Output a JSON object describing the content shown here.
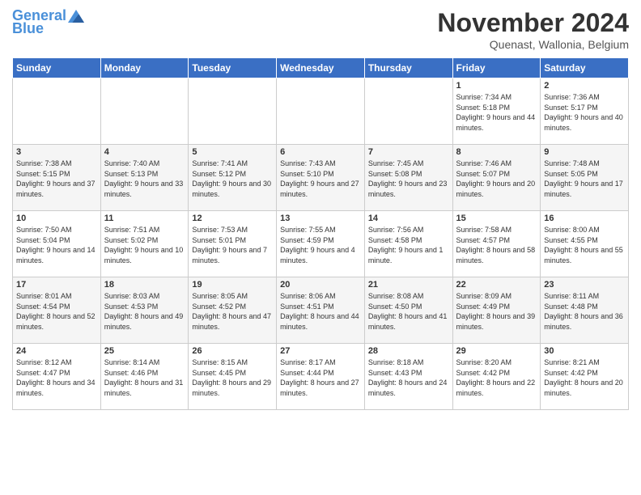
{
  "header": {
    "logo_line1": "General",
    "logo_line2": "Blue",
    "month_title": "November 2024",
    "location": "Quenast, Wallonia, Belgium"
  },
  "days_of_week": [
    "Sunday",
    "Monday",
    "Tuesday",
    "Wednesday",
    "Thursday",
    "Friday",
    "Saturday"
  ],
  "weeks": [
    [
      {
        "day": "",
        "info": ""
      },
      {
        "day": "",
        "info": ""
      },
      {
        "day": "",
        "info": ""
      },
      {
        "day": "",
        "info": ""
      },
      {
        "day": "",
        "info": ""
      },
      {
        "day": "1",
        "info": "Sunrise: 7:34 AM\nSunset: 5:18 PM\nDaylight: 9 hours and 44 minutes."
      },
      {
        "day": "2",
        "info": "Sunrise: 7:36 AM\nSunset: 5:17 PM\nDaylight: 9 hours and 40 minutes."
      }
    ],
    [
      {
        "day": "3",
        "info": "Sunrise: 7:38 AM\nSunset: 5:15 PM\nDaylight: 9 hours and 37 minutes."
      },
      {
        "day": "4",
        "info": "Sunrise: 7:40 AM\nSunset: 5:13 PM\nDaylight: 9 hours and 33 minutes."
      },
      {
        "day": "5",
        "info": "Sunrise: 7:41 AM\nSunset: 5:12 PM\nDaylight: 9 hours and 30 minutes."
      },
      {
        "day": "6",
        "info": "Sunrise: 7:43 AM\nSunset: 5:10 PM\nDaylight: 9 hours and 27 minutes."
      },
      {
        "day": "7",
        "info": "Sunrise: 7:45 AM\nSunset: 5:08 PM\nDaylight: 9 hours and 23 minutes."
      },
      {
        "day": "8",
        "info": "Sunrise: 7:46 AM\nSunset: 5:07 PM\nDaylight: 9 hours and 20 minutes."
      },
      {
        "day": "9",
        "info": "Sunrise: 7:48 AM\nSunset: 5:05 PM\nDaylight: 9 hours and 17 minutes."
      }
    ],
    [
      {
        "day": "10",
        "info": "Sunrise: 7:50 AM\nSunset: 5:04 PM\nDaylight: 9 hours and 14 minutes."
      },
      {
        "day": "11",
        "info": "Sunrise: 7:51 AM\nSunset: 5:02 PM\nDaylight: 9 hours and 10 minutes."
      },
      {
        "day": "12",
        "info": "Sunrise: 7:53 AM\nSunset: 5:01 PM\nDaylight: 9 hours and 7 minutes."
      },
      {
        "day": "13",
        "info": "Sunrise: 7:55 AM\nSunset: 4:59 PM\nDaylight: 9 hours and 4 minutes."
      },
      {
        "day": "14",
        "info": "Sunrise: 7:56 AM\nSunset: 4:58 PM\nDaylight: 9 hours and 1 minute."
      },
      {
        "day": "15",
        "info": "Sunrise: 7:58 AM\nSunset: 4:57 PM\nDaylight: 8 hours and 58 minutes."
      },
      {
        "day": "16",
        "info": "Sunrise: 8:00 AM\nSunset: 4:55 PM\nDaylight: 8 hours and 55 minutes."
      }
    ],
    [
      {
        "day": "17",
        "info": "Sunrise: 8:01 AM\nSunset: 4:54 PM\nDaylight: 8 hours and 52 minutes."
      },
      {
        "day": "18",
        "info": "Sunrise: 8:03 AM\nSunset: 4:53 PM\nDaylight: 8 hours and 49 minutes."
      },
      {
        "day": "19",
        "info": "Sunrise: 8:05 AM\nSunset: 4:52 PM\nDaylight: 8 hours and 47 minutes."
      },
      {
        "day": "20",
        "info": "Sunrise: 8:06 AM\nSunset: 4:51 PM\nDaylight: 8 hours and 44 minutes."
      },
      {
        "day": "21",
        "info": "Sunrise: 8:08 AM\nSunset: 4:50 PM\nDaylight: 8 hours and 41 minutes."
      },
      {
        "day": "22",
        "info": "Sunrise: 8:09 AM\nSunset: 4:49 PM\nDaylight: 8 hours and 39 minutes."
      },
      {
        "day": "23",
        "info": "Sunrise: 8:11 AM\nSunset: 4:48 PM\nDaylight: 8 hours and 36 minutes."
      }
    ],
    [
      {
        "day": "24",
        "info": "Sunrise: 8:12 AM\nSunset: 4:47 PM\nDaylight: 8 hours and 34 minutes."
      },
      {
        "day": "25",
        "info": "Sunrise: 8:14 AM\nSunset: 4:46 PM\nDaylight: 8 hours and 31 minutes."
      },
      {
        "day": "26",
        "info": "Sunrise: 8:15 AM\nSunset: 4:45 PM\nDaylight: 8 hours and 29 minutes."
      },
      {
        "day": "27",
        "info": "Sunrise: 8:17 AM\nSunset: 4:44 PM\nDaylight: 8 hours and 27 minutes."
      },
      {
        "day": "28",
        "info": "Sunrise: 8:18 AM\nSunset: 4:43 PM\nDaylight: 8 hours and 24 minutes."
      },
      {
        "day": "29",
        "info": "Sunrise: 8:20 AM\nSunset: 4:42 PM\nDaylight: 8 hours and 22 minutes."
      },
      {
        "day": "30",
        "info": "Sunrise: 8:21 AM\nSunset: 4:42 PM\nDaylight: 8 hours and 20 minutes."
      }
    ]
  ]
}
